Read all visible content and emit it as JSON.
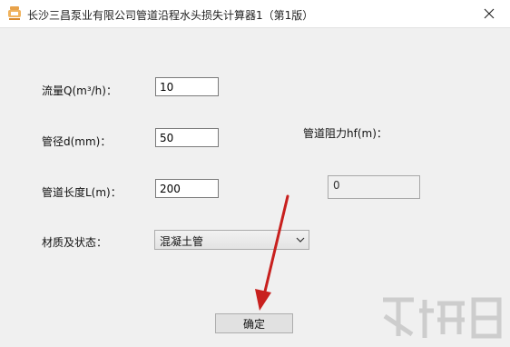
{
  "window": {
    "title": "长沙三昌泵业有限公司管道沿程水头损失计算器1（第1版）",
    "icon": "app-logo-icon",
    "close_icon": "close-icon"
  },
  "form": {
    "flow": {
      "label": "流量Q(m³/h)：",
      "value": "10"
    },
    "diameter": {
      "label": "管径d(mm)：",
      "value": "50"
    },
    "length": {
      "label": "管道长度L(m)：",
      "value": "200"
    },
    "material": {
      "label": "材质及状态：",
      "selected": "混凝土管"
    },
    "result": {
      "label": "管道阻力hf(m)：",
      "value": "0"
    },
    "submit_label": "确定"
  },
  "colors": {
    "annotation_arrow": "#c8201e",
    "window_bg": "#f0f0f0"
  }
}
